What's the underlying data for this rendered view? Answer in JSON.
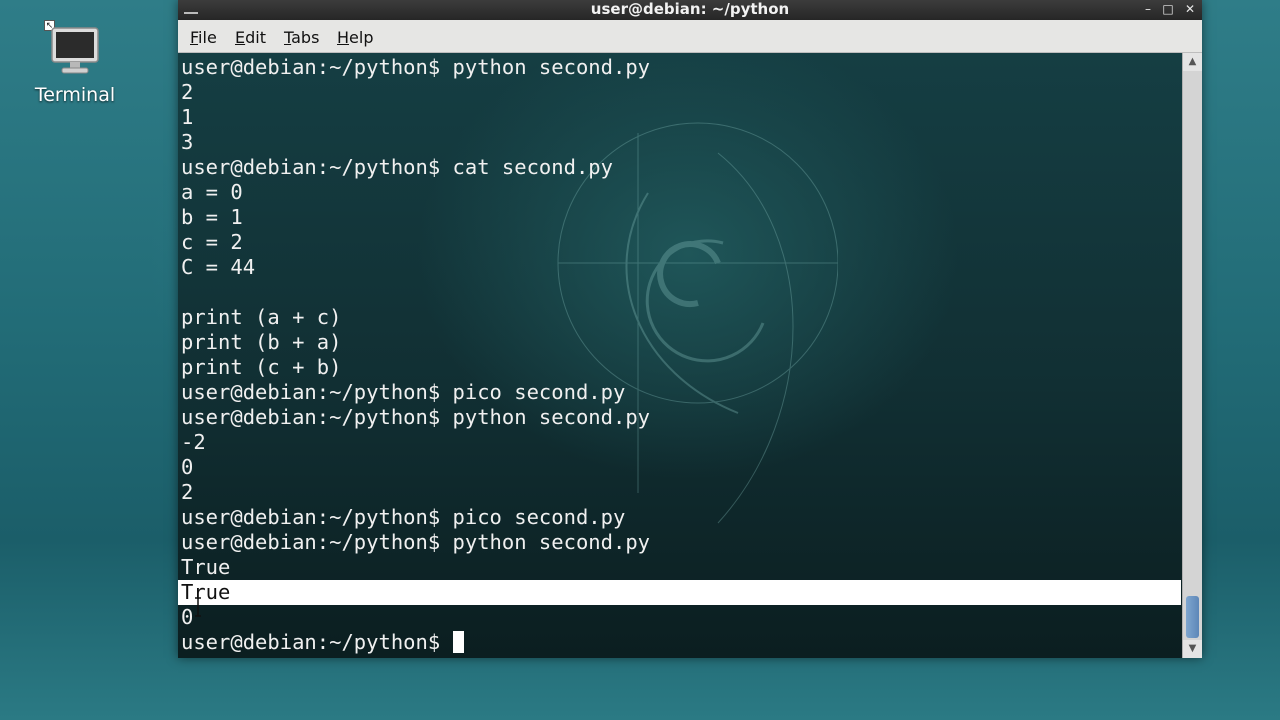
{
  "desktop": {
    "icon_label": "Terminal",
    "shortcut_badge": "↖"
  },
  "window": {
    "title": "user@debian: ~/python",
    "controls": {
      "minimize": "–",
      "maximize": "□",
      "close": "✕"
    }
  },
  "menubar": {
    "items": [
      {
        "accel": "F",
        "rest": "ile"
      },
      {
        "accel": "E",
        "rest": "dit"
      },
      {
        "accel": "T",
        "rest": "abs"
      },
      {
        "accel": "H",
        "rest": "elp"
      }
    ]
  },
  "terminal": {
    "lines": [
      "user@debian:~/python$ python second.py",
      "2",
      "1",
      "3",
      "user@debian:~/python$ cat second.py",
      "a = 0",
      "b = 1",
      "c = 2",
      "C = 44",
      "",
      "print (a + c)",
      "print (b + a)",
      "print (c + b)",
      "user@debian:~/python$ pico second.py",
      "user@debian:~/python$ python second.py",
      "-2",
      "0",
      "2",
      "user@debian:~/python$ pico second.py",
      "user@debian:~/python$ python second.py",
      "True",
      "True",
      "0",
      "user@debian:~/python$ "
    ],
    "selected_line_index": 21,
    "cursor_line_index": 23
  },
  "scrollbar": {
    "up_arrow": "▲",
    "down_arrow": "▼"
  },
  "colors": {
    "terminal_text": "#f0f0f0",
    "selection_background": "#ffffff",
    "scrollbar_thumb": "#6f97c4",
    "titlebar": "#2e2e2e"
  }
}
